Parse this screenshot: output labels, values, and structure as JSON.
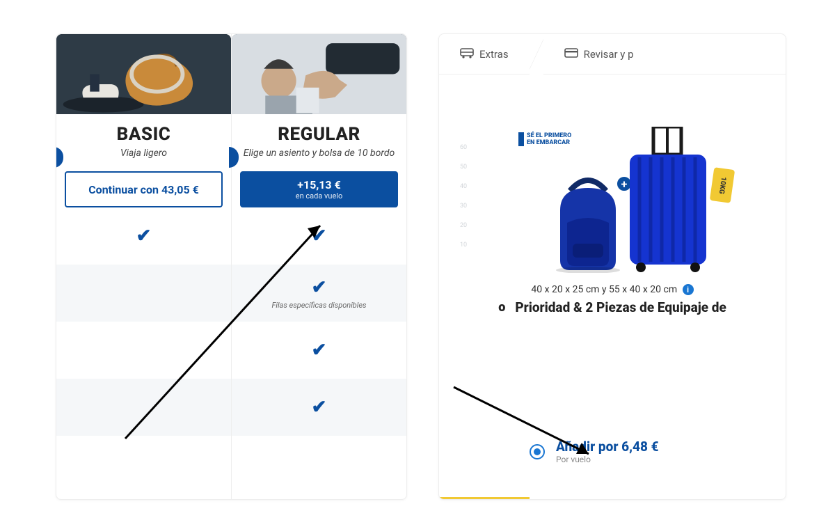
{
  "left_panel": {
    "basic": {
      "title": "BASIC",
      "subtitle": "Viaja ligero",
      "button_label": "Continuar con 43,05 €"
    },
    "regular": {
      "title": "REGULAR",
      "subtitle": "Elige un asiento y bolsa de 10 bordo",
      "button_price": "+15,13 €",
      "button_sub": "en cada vuelo",
      "row2_note": "Filas específicas disponibles"
    }
  },
  "right_panel": {
    "steps": {
      "extras": "Extras",
      "review": "Revisar y p"
    },
    "ruler": [
      "60",
      "50",
      "40",
      "30",
      "20",
      "10"
    ],
    "first_to_board_l1": "SÉ EL PRIMERO",
    "first_to_board_l2": "EN EMBARCAR",
    "tag_10kg": "10KG",
    "dimensions": "40 x 20 x 25 cm y 55 x 40 x 20 cm",
    "priority_o": "o",
    "priority_title": "Prioridad & 2 Piezas de Equipaje de",
    "add_label": "Añadir por 6,48 €",
    "add_sub": "Por vuelo"
  }
}
